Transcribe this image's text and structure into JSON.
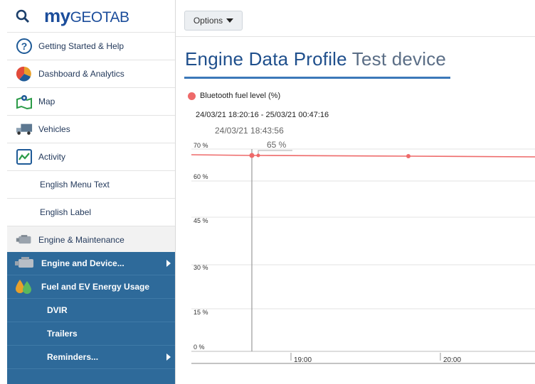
{
  "logo": {
    "my": "my",
    "rest": "GEOTAB"
  },
  "sidebar": {
    "items": [
      {
        "label": "Getting Started & Help",
        "icon": "help-icon"
      },
      {
        "label": "Dashboard & Analytics",
        "icon": "dashboard-icon"
      },
      {
        "label": "Map",
        "icon": "map-icon"
      },
      {
        "label": "Vehicles",
        "icon": "truck-icon"
      },
      {
        "label": "Activity",
        "icon": "activity-icon"
      },
      {
        "label": "English Menu Text"
      },
      {
        "label": "English Label"
      },
      {
        "label": "Engine & Maintenance",
        "icon": "engine-icon"
      }
    ],
    "subnav": [
      {
        "label": "Engine and Device...",
        "icon": "engine-icon"
      },
      {
        "label": "Fuel and EV Energy Usage",
        "icon": "fuel-icon"
      },
      {
        "label": "DVIR"
      },
      {
        "label": "Trailers"
      },
      {
        "label": "Reminders..."
      }
    ]
  },
  "toolbar": {
    "options_label": "Options"
  },
  "page": {
    "title": "Engine Data Profile",
    "device": "Test device"
  },
  "chart": {
    "legend": "Bluetooth fuel level (%)",
    "range": "24/03/21 18:20:16 - 25/03/21 00:47:16",
    "cursor_time": "24/03/21 18:43:56",
    "cursor_value": "65 %",
    "colors": {
      "line": "#ee6a6a",
      "cursor": "#999999"
    }
  },
  "chart_data": {
    "type": "line",
    "series": [
      {
        "name": "Bluetooth fuel level (%)",
        "x": [
          "18:43",
          "18:44",
          "19:40",
          "20:40"
        ],
        "y": [
          65,
          65,
          64,
          64
        ]
      }
    ],
    "yticks": [
      "70 %",
      "60 %",
      "45 %",
      "30 %",
      "15 %",
      "0 %"
    ],
    "xticks": [
      "19:00",
      "20:00"
    ],
    "ylim": [
      0,
      70
    ]
  }
}
